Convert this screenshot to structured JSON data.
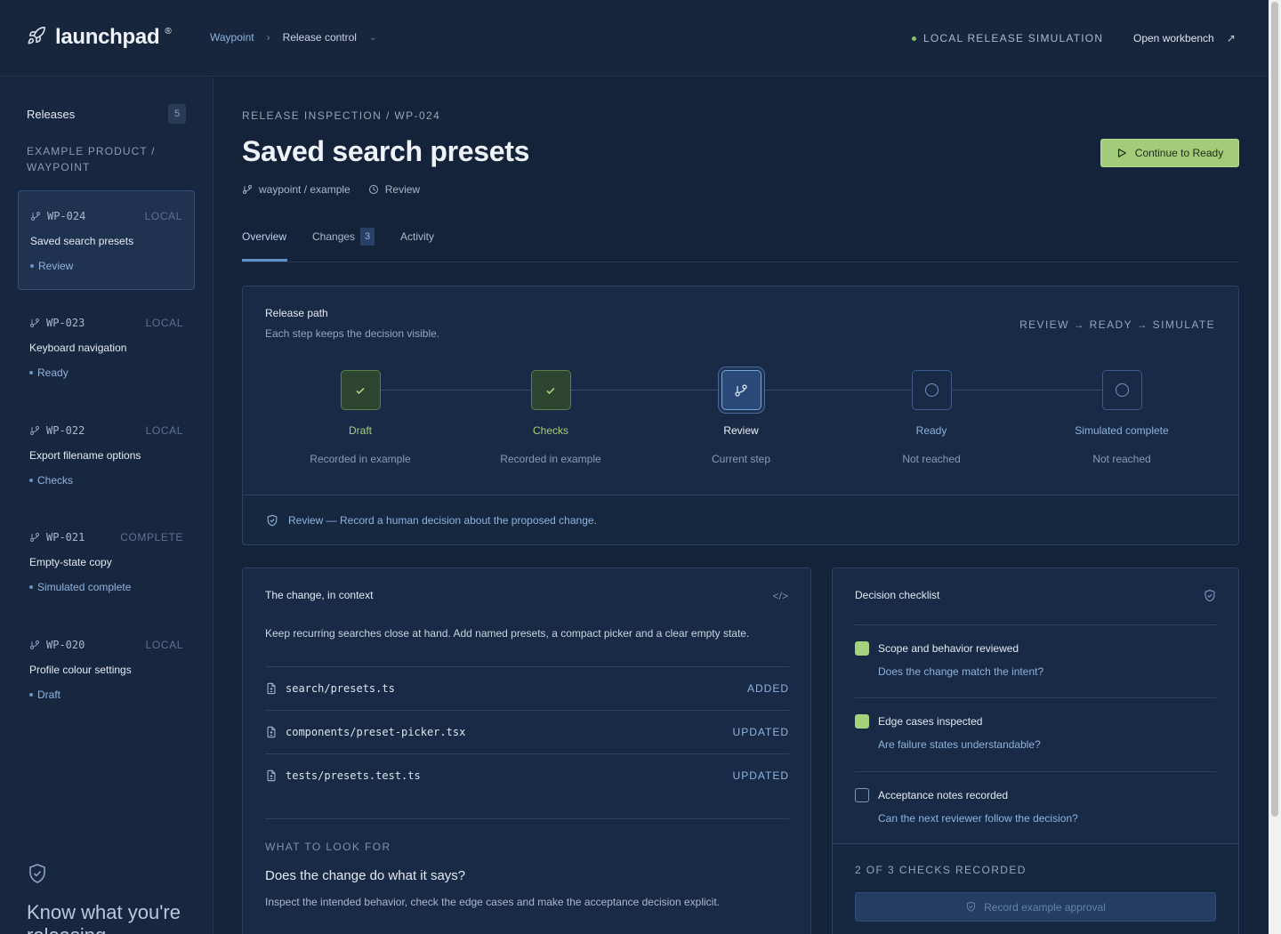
{
  "app": {
    "name": "launchpad",
    "reg": "®"
  },
  "breadcrumb": {
    "project": "Waypoint",
    "current": "Release control"
  },
  "header": {
    "simulation_label": "LOCAL RELEASE SIMULATION",
    "open_workbench": "Open workbench"
  },
  "sidebar": {
    "heading": "Releases",
    "count": "5",
    "product": "EXAMPLE PRODUCT / WAYPOINT",
    "releases": [
      {
        "id": "WP-024",
        "status": "LOCAL",
        "title": "Saved search presets",
        "stage": "Review",
        "active": true
      },
      {
        "id": "WP-023",
        "status": "LOCAL",
        "title": "Keyboard navigation",
        "stage": "Ready"
      },
      {
        "id": "WP-022",
        "status": "LOCAL",
        "title": "Export filename options",
        "stage": "Checks"
      },
      {
        "id": "WP-021",
        "status": "COMPLETE",
        "title": "Empty-state copy",
        "stage": "Simulated complete"
      },
      {
        "id": "WP-020",
        "status": "LOCAL",
        "title": "Profile colour settings",
        "stage": "Draft"
      }
    ],
    "tagline": "Know what you're releasing."
  },
  "page": {
    "eyebrow": "RELEASE INSPECTION / WP-024",
    "title": "Saved search presets",
    "repo": "waypoint / example",
    "stage": "Review",
    "cta": "Continue to Ready",
    "tabs": [
      {
        "label": "Overview",
        "active": true
      },
      {
        "label": "Changes",
        "badge": "3"
      },
      {
        "label": "Activity"
      }
    ]
  },
  "release_path": {
    "title": "Release path",
    "subtitle": "Each step keeps the decision visible.",
    "flow": "REVIEW → READY → SIMULATE",
    "steps": [
      {
        "label": "Draft",
        "note": "Recorded in example",
        "state": "done"
      },
      {
        "label": "Checks",
        "note": "Recorded in example",
        "state": "done"
      },
      {
        "label": "Review",
        "note": "Current step",
        "state": "current"
      },
      {
        "label": "Ready",
        "note": "Not reached",
        "state": "pending"
      },
      {
        "label": "Simulated complete",
        "note": "Not reached",
        "state": "pending"
      }
    ],
    "footer": "Review — Record a human decision about the proposed change."
  },
  "change": {
    "title": "The change, in context",
    "description": "Keep recurring searches close at hand. Add named presets, a compact picker and a clear empty state.",
    "files": [
      {
        "path": "search/presets.ts",
        "state": "ADDED"
      },
      {
        "path": "components/preset-picker.tsx",
        "state": "UPDATED"
      },
      {
        "path": "tests/presets.test.ts",
        "state": "UPDATED"
      }
    ],
    "look_eyebrow": "WHAT TO LOOK FOR",
    "look_question": "Does the change do what it says?",
    "look_text": "Inspect the intended behavior, check the edge cases and make the acceptance decision explicit."
  },
  "checklist": {
    "title": "Decision checklist",
    "items": [
      {
        "title": "Scope and behavior reviewed",
        "question": "Does the change match the intent?",
        "checked": true
      },
      {
        "title": "Edge cases inspected",
        "question": "Are failure states understandable?",
        "checked": true
      },
      {
        "title": "Acceptance notes recorded",
        "question": "Can the next reviewer follow the decision?",
        "checked": false
      }
    ],
    "summary": "2 OF 3 CHECKS RECORDED",
    "approve": "Record example approval"
  }
}
